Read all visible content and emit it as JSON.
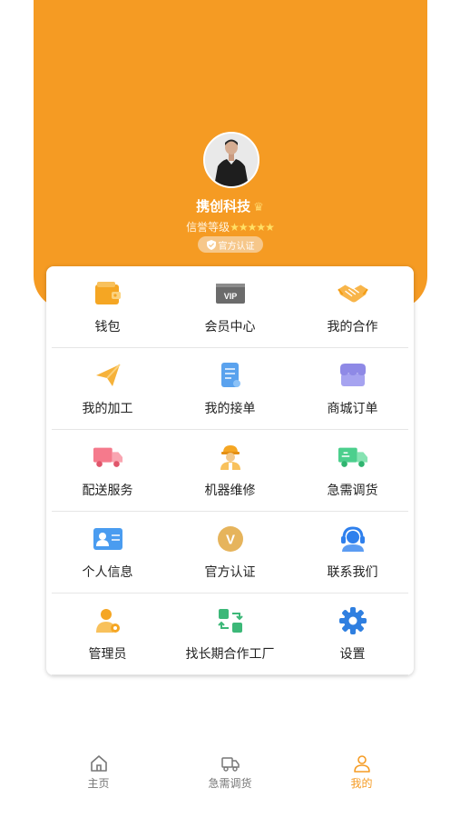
{
  "profile": {
    "name": "携创科技",
    "credit_label": "信誉等级",
    "credit_stars": "★★★★★",
    "badge": "官方认证",
    "rating": 5
  },
  "menu": [
    {
      "label": "钱包",
      "icon": "wallet-icon"
    },
    {
      "label": "会员中心",
      "icon": "vip-card-icon"
    },
    {
      "label": "我的合作",
      "icon": "handshake-icon"
    },
    {
      "label": "我的加工",
      "icon": "paper-plane-icon"
    },
    {
      "label": "我的接单",
      "icon": "document-icon"
    },
    {
      "label": "商城订单",
      "icon": "store-icon"
    },
    {
      "label": "配送服务",
      "icon": "delivery-truck-icon"
    },
    {
      "label": "机器维修",
      "icon": "repair-worker-icon"
    },
    {
      "label": "急需调货",
      "icon": "express-truck-icon"
    },
    {
      "label": "个人信息",
      "icon": "id-card-icon"
    },
    {
      "label": "官方认证",
      "icon": "v-certified-icon"
    },
    {
      "label": "联系我们",
      "icon": "customer-service-icon"
    },
    {
      "label": "管理员",
      "icon": "admin-user-icon"
    },
    {
      "label": "找长期合作工厂",
      "icon": "exchange-icon"
    },
    {
      "label": "设置",
      "icon": "settings-gear-icon"
    }
  ],
  "tabs": [
    {
      "label": "主页",
      "icon": "home-icon"
    },
    {
      "label": "急需调货",
      "icon": "truck-icon"
    },
    {
      "label": "我的",
      "icon": "user-icon"
    }
  ],
  "colors": {
    "accent": "#f59b23",
    "active_tab": "#f59b23",
    "inactive_tab": "#777777"
  }
}
